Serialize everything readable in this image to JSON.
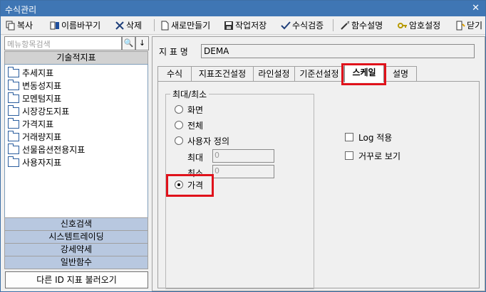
{
  "window": {
    "title": "수식관리",
    "close": "✕"
  },
  "toolbar": [
    {
      "label": "복사",
      "icon": "copy-icon"
    },
    {
      "label": "이름바꾸기",
      "icon": "rename-icon"
    },
    {
      "label": "삭제",
      "icon": "delete-icon"
    },
    {
      "label": "새로만들기",
      "icon": "new-file-icon"
    },
    {
      "label": "작업저장",
      "icon": "save-icon"
    },
    {
      "label": "수식검증",
      "icon": "checkmark-icon"
    },
    {
      "label": "함수설명",
      "icon": "magic-wand-icon"
    },
    {
      "label": "암호설정",
      "icon": "key-icon"
    },
    {
      "label": "닫기",
      "icon": "door-exit-icon"
    }
  ],
  "sidebar": {
    "search_placeholder": "메뉴항목검색",
    "search_btn": "🔍",
    "down_btn": "↓",
    "top_category": "기술적지표",
    "items": [
      "추세지표",
      "변동성지표",
      "모멘텀지표",
      "시장강도지표",
      "가격지표",
      "거래량지표",
      "선물옵션전용지표",
      "사용자지표"
    ],
    "bottom_categories": [
      "신호검색",
      "시스템트레이딩",
      "강세약세",
      "일반함수"
    ],
    "load_button": "다른 ID 지표 불러오기"
  },
  "main": {
    "name_label": "지 표 명",
    "name_value": "DEMA",
    "tabs": [
      "수식",
      "지표조건설정",
      "라인설정",
      "기준선설정",
      "스케일",
      "설명"
    ],
    "selected_tab": "스케일",
    "scale": {
      "group_label": "최대/최소",
      "options": [
        "화면",
        "전체",
        "사용자 정의",
        "가격"
      ],
      "selected": "가격",
      "max_label": "최대",
      "max_value": "0",
      "min_label": "최소",
      "min_value": "0",
      "log_label": "Log 적용",
      "reverse_label": "거꾸로 보기"
    }
  },
  "colors": {
    "titlebar": "#3f76b4",
    "highlight": "#e0121b"
  }
}
